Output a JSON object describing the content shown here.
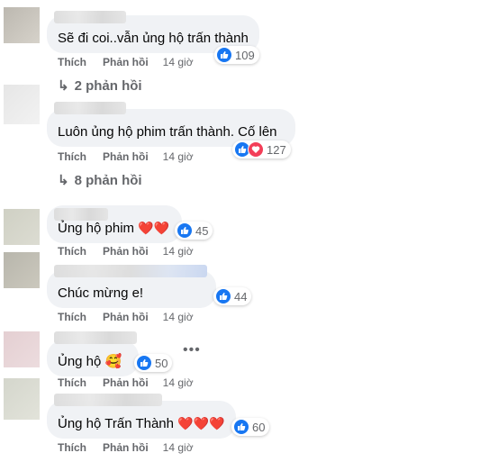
{
  "comments": [
    {
      "text": "Sẽ đi coi..vẫn ủng hộ trấn thành",
      "reactions": "109",
      "like": "Thích",
      "reply": "Phản hồi",
      "time": "14 giờ",
      "replies": "2 phản hồi"
    },
    {
      "text": "Luôn ủng hộ phim trấn thành. Cố lên",
      "reactions": "127",
      "like": "Thích",
      "reply": "Phản hồi",
      "time": "14 giờ",
      "replies": "8 phản hồi"
    },
    {
      "text": "Ủng hộ phim",
      "emoji": "❤️❤️",
      "reactions": "45",
      "like": "Thích",
      "reply": "Phản hồi",
      "time": "14 giờ"
    },
    {
      "text": "Chúc mừng e!",
      "reactions": "44",
      "like": "Thích",
      "reply": "Phản hồi",
      "time": "14 giờ"
    },
    {
      "text": "Ủng hộ",
      "emoji": "🥰",
      "reactions": "50",
      "like": "Thích",
      "reply": "Phản hồi",
      "time": "14 giờ"
    },
    {
      "text": "Ủng hộ Trấn Thành",
      "emoji": "❤️❤️❤️",
      "reactions": "60",
      "like": "Thích",
      "reply": "Phản hồi",
      "time": "14 giờ"
    }
  ],
  "more_label": "•••",
  "colors": {
    "like": "#1877f2",
    "love": "#f33e58",
    "bubble": "#f0f2f5",
    "meta": "#65676b"
  }
}
